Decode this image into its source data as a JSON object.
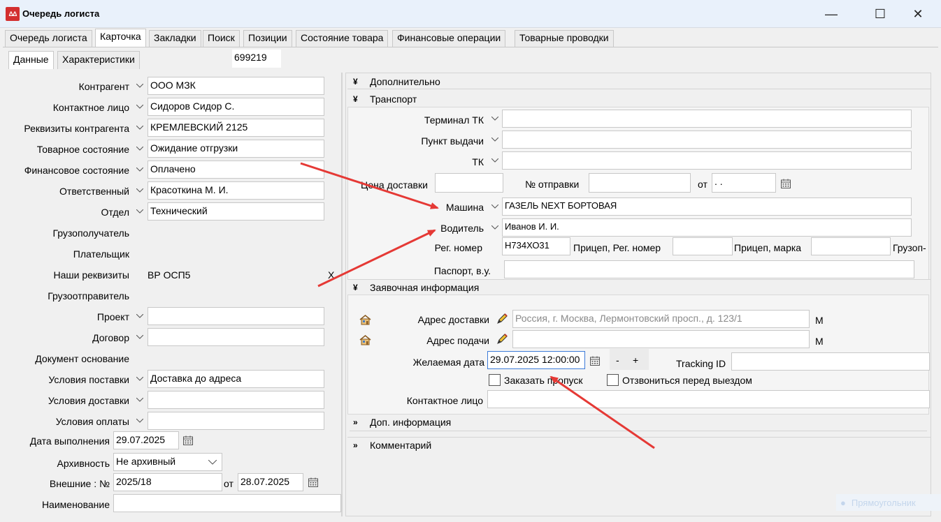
{
  "window": {
    "title": "Очередь логиста",
    "icon_text": "ΔΔ",
    "minimize": "—",
    "maximize": "☐",
    "close": "✕"
  },
  "tabs": [
    {
      "label": "Очередь логиста"
    },
    {
      "label": "Карточка"
    },
    {
      "label": "Закладки"
    },
    {
      "label": "Поиск"
    },
    {
      "label": "Позиции"
    },
    {
      "label": "Состояние товара"
    },
    {
      "label": "Финансовые операции"
    },
    {
      "label": "Товарные проводки"
    }
  ],
  "subtabs": [
    {
      "label": "Данные"
    },
    {
      "label": "Характеристики"
    }
  ],
  "card_id": "699219",
  "left": {
    "kontragent": {
      "label": "Контрагент",
      "value": "ООО МЗК"
    },
    "contact": {
      "label": "Контактное лицо",
      "value": "Сидоров Сидор С."
    },
    "requisites": {
      "label": "Реквизиты контрагента",
      "value": "КРЕМЛЕВСКИЙ 2125"
    },
    "goods_state": {
      "label": "Товарное состояние",
      "value": "Ожидание отгрузки"
    },
    "fin_state": {
      "label": "Финансовое состояние",
      "value": "Оплачено"
    },
    "responsible": {
      "label": "Ответственный",
      "value": "Красоткина М. И."
    },
    "department": {
      "label": "Отдел",
      "value": "Технический"
    },
    "consignee": {
      "label": "Грузополучатель"
    },
    "payer": {
      "label": "Плательщик"
    },
    "our_requisites": {
      "label": "Наши реквизиты",
      "value": "ВР ОСП5",
      "clear": "X"
    },
    "shipper": {
      "label": "Грузоотправитель"
    },
    "project": {
      "label": "Проект",
      "value": ""
    },
    "contract": {
      "label": "Договор",
      "value": ""
    },
    "base_doc": {
      "label": "Документ основание"
    },
    "delivery_terms": {
      "label": "Условия поставки",
      "value": "Доставка до адреса"
    },
    "shipping_terms": {
      "label": "Условия доставки",
      "value": ""
    },
    "payment_terms": {
      "label": "Условия оплаты",
      "value": ""
    },
    "done_date": {
      "label": "Дата выполнения",
      "value": "29.07.2025"
    },
    "archive": {
      "label": "Архивность",
      "value": "Не архивный"
    },
    "external": {
      "label": "Внешние : №",
      "value": "2025/18",
      "from_label": "от",
      "from_value": "28.07.2025"
    },
    "name": {
      "label": "Наименование",
      "value": ""
    }
  },
  "right": {
    "additional": {
      "label": "Дополнительно"
    },
    "transport": {
      "label": "Транспорт",
      "terminal": {
        "label": "Терминал ТК",
        "value": ""
      },
      "pickup": {
        "label": "Пункт выдачи",
        "value": ""
      },
      "tk": {
        "label": "ТК",
        "value": ""
      },
      "delivery_price": {
        "label": "Цена доставки",
        "value": ""
      },
      "shipment_no": {
        "label": "№ отправки",
        "value": ""
      },
      "from_label": "от",
      "from_value": " .  .",
      "vehicle": {
        "label": "Машина",
        "value": "ГАЗЕЛЬ NEXT БОРТОВАЯ"
      },
      "driver": {
        "label": "Водитель",
        "value": "Иванов И. И."
      },
      "reg_no": {
        "label": "Рег. номер",
        "value": "Н734ХО31"
      },
      "trailer_reg": {
        "label": "Прицеп, Рег. номер",
        "value": ""
      },
      "trailer_brand": {
        "label": "Прицеп, марка",
        "value": ""
      },
      "cargo_cut": {
        "label": "Грузоп-"
      },
      "passport": {
        "label": "Паспорт, в.у.",
        "value": ""
      }
    },
    "request": {
      "label": "Заявочная информация",
      "delivery_address": {
        "label": "Адрес доставки",
        "value": "Россия, г. Москва, Лермонтовский просп., д. 123/1",
        "suffix": "М"
      },
      "pickup_address": {
        "label": "Адрес подачи",
        "value": "",
        "suffix": "М"
      },
      "desired_date": {
        "label": "Желаемая дата",
        "value": "29.07.2025 12:00:00",
        "minus": "-",
        "plus": "+"
      },
      "tracking": {
        "label": "Tracking ID",
        "value": ""
      },
      "order_pass": {
        "label": "Заказать пропуск",
        "checked": false
      },
      "call_before": {
        "label": "Отзвониться перед выездом",
        "checked": false
      },
      "contact": {
        "label": "Контактное лицо",
        "value": ""
      }
    },
    "extra_info": {
      "label": "Доп. информация"
    },
    "comment": {
      "label": "Комментарий"
    }
  },
  "watermark": "Прямоугольник",
  "colors": {
    "arrow": "#e53935",
    "titlebar": "#e9f1fb",
    "app_icon": "#d32f2f"
  }
}
